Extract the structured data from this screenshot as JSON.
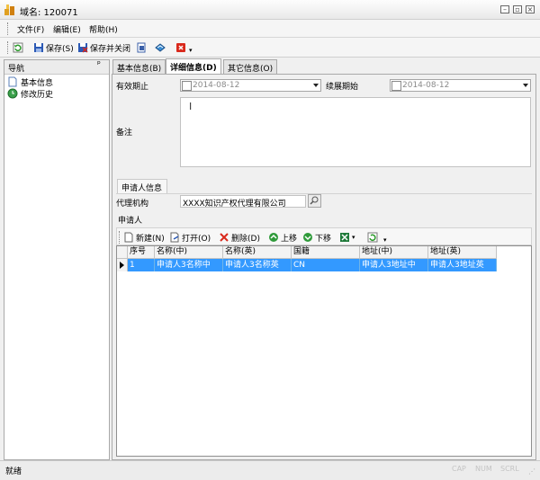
{
  "window": {
    "title": "域名: 120071"
  },
  "menu": [
    {
      "label": "文件(F)"
    },
    {
      "label": "编辑(E)"
    },
    {
      "label": "帮助(H)"
    }
  ],
  "toolbar": {
    "save": "保存(S)",
    "save_close": "保存并关闭"
  },
  "nav": {
    "header": "导航",
    "pin": "ᵖ",
    "items": [
      {
        "label": "基本信息"
      },
      {
        "label": "修改历史"
      }
    ]
  },
  "tabs": [
    {
      "label": "基本信息(B)"
    },
    {
      "label": "详细信息(D)"
    },
    {
      "label": "其它信息(O)"
    }
  ],
  "form": {
    "expiry_label": "有效期止",
    "expiry_value": "2014-08-12",
    "renew_label": "续展期始",
    "renew_value": "2014-08-12",
    "memo_label": "备注",
    "applicant_group": "申请人信息",
    "agency_label": "代理机构",
    "agency_value": "XXXX知识产权代理有限公司"
  },
  "applicant": {
    "section_label": "申请人",
    "buttons": {
      "new": "新建(N)",
      "open": "打开(O)",
      "delete": "删除(D)",
      "up": "上移",
      "down": "下移"
    },
    "columns": [
      "序号",
      "名称(中)",
      "名称(英)",
      "国籍",
      "地址(中)",
      "地址(英)"
    ],
    "rows": [
      [
        "1",
        "申请人3名称中",
        "申请人3名称英",
        "CN",
        "申请人3地址中",
        "申请人3地址英"
      ]
    ]
  },
  "status": {
    "text": "就绪",
    "cap": "CAP",
    "num": "NUM",
    "scrl": "SCRL"
  },
  "colors": {
    "selection": "#3399ff",
    "accent_red": "#d9291c"
  }
}
